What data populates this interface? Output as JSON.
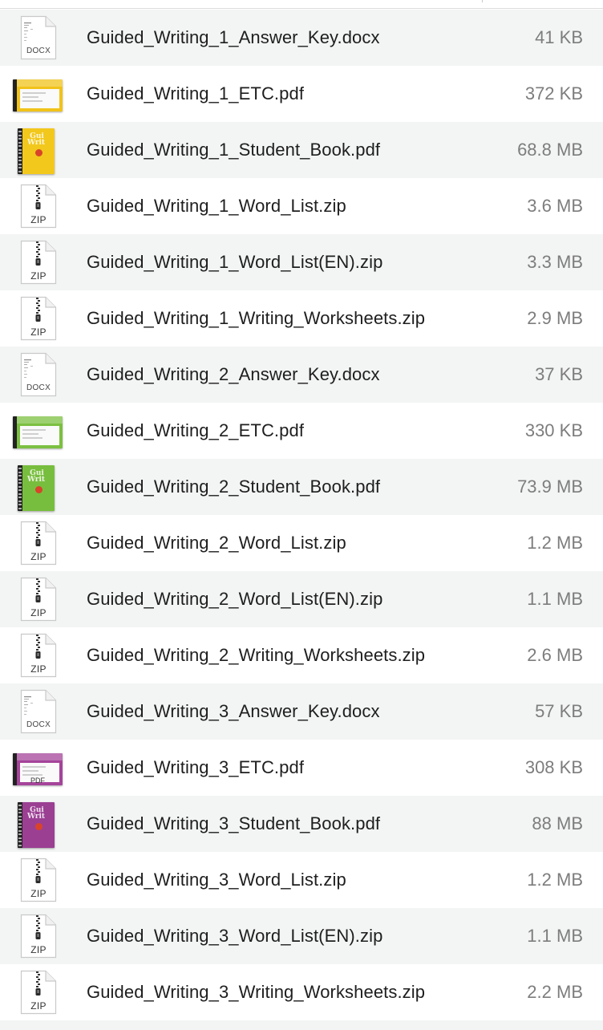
{
  "files": [
    {
      "name": "Guided_Writing_1_Answer_Key.docx",
      "size": "41 KB",
      "icon": "docx-file-icon",
      "icon_label": "DOCX"
    },
    {
      "name": "Guided_Writing_1_ETC.pdf",
      "size": "372 KB",
      "icon": "pdf-thumbnail-icon",
      "cover_color": "#f1c31a"
    },
    {
      "name": "Guided_Writing_1_Student_Book.pdf",
      "size": "68.8 MB",
      "icon": "book-cover-icon",
      "cover_color": "#f2c81c"
    },
    {
      "name": "Guided_Writing_1_Word_List.zip",
      "size": "3.6 MB",
      "icon": "zip-file-icon",
      "icon_label": "ZIP"
    },
    {
      "name": "Guided_Writing_1_Word_List(EN).zip",
      "size": "3.3 MB",
      "icon": "zip-file-icon",
      "icon_label": "ZIP"
    },
    {
      "name": "Guided_Writing_1_Writing_Worksheets.zip",
      "size": "2.9 MB",
      "icon": "zip-file-icon",
      "icon_label": "ZIP"
    },
    {
      "name": "Guided_Writing_2_Answer_Key.docx",
      "size": "37 KB",
      "icon": "docx-file-icon",
      "icon_label": "DOCX"
    },
    {
      "name": "Guided_Writing_2_ETC.pdf",
      "size": "330 KB",
      "icon": "pdf-thumbnail-icon",
      "cover_color": "#7cc041"
    },
    {
      "name": "Guided_Writing_2_Student_Book.pdf",
      "size": "73.9 MB",
      "icon": "book-cover-icon",
      "cover_color": "#78be3e"
    },
    {
      "name": "Guided_Writing_2_Word_List.zip",
      "size": "1.2 MB",
      "icon": "zip-file-icon",
      "icon_label": "ZIP"
    },
    {
      "name": "Guided_Writing_2_Word_List(EN).zip",
      "size": "1.1 MB",
      "icon": "zip-file-icon",
      "icon_label": "ZIP"
    },
    {
      "name": "Guided_Writing_2_Writing_Worksheets.zip",
      "size": "2.6 MB",
      "icon": "zip-file-icon",
      "icon_label": "ZIP"
    },
    {
      "name": "Guided_Writing_3_Answer_Key.docx",
      "size": "57 KB",
      "icon": "docx-file-icon",
      "icon_label": "DOCX"
    },
    {
      "name": "Guided_Writing_3_ETC.pdf",
      "size": "308 KB",
      "icon": "pdf-thumbnail-icon",
      "cover_color": "#a5449a",
      "icon_label": "PDF"
    },
    {
      "name": "Guided_Writing_3_Student_Book.pdf",
      "size": "88 MB",
      "icon": "book-cover-icon",
      "cover_color": "#9b3f93"
    },
    {
      "name": "Guided_Writing_3_Word_List.zip",
      "size": "1.2 MB",
      "icon": "zip-file-icon",
      "icon_label": "ZIP"
    },
    {
      "name": "Guided_Writing_3_Word_List(EN).zip",
      "size": "1.1 MB",
      "icon": "zip-file-icon",
      "icon_label": "ZIP"
    },
    {
      "name": "Guided_Writing_3_Writing_Worksheets.zip",
      "size": "2.2 MB",
      "icon": "zip-file-icon",
      "icon_label": "ZIP"
    }
  ],
  "colors": {
    "row_alt": "#f3f4f4",
    "row_plain": "#ffffff",
    "name_text": "#1e1e1e",
    "size_text": "#7d7d7d"
  }
}
